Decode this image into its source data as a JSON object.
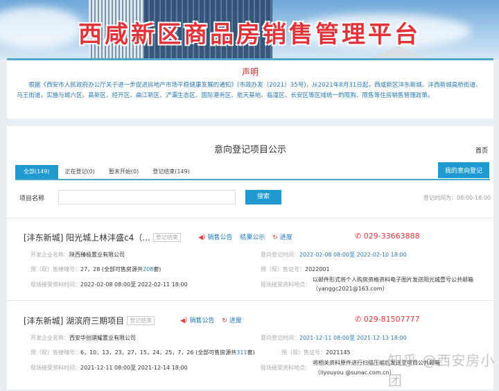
{
  "banner": {
    "title": "西咸新区商品房销售管理平台"
  },
  "notice": {
    "title": "声明",
    "body": "根据《西安市人民政府办公厅关于进一步促进房地产市场平稳健康发展的通知》(市政办发〔2021〕35号)，从2021年8月31日起，西咸新区沣东新城、沣西新城高桥街道、马王街道，实施与城六区、高新区、经开区、曲江新区、浐灞生态区、国际港务区、航天基地、临潼区、长安区等区域统一的限购、限售等住房销售管理政策。"
  },
  "page": {
    "title": "意向登记项目公示",
    "home": "首页",
    "my_button": "我的意向登记"
  },
  "tabs": [
    {
      "label": "全部(149)"
    },
    {
      "label": "正在登记(0)"
    },
    {
      "label": "暂未开始(0)"
    },
    {
      "label": "登记结束(149)"
    }
  ],
  "search": {
    "label": "项目名称",
    "value": "",
    "button": "搜索",
    "time_note": "登记时间为：08:00-18:00"
  },
  "items": [
    {
      "name": "[沣东新城] 阳光城上林沣盛c4（...",
      "badge": "登记结束",
      "links": [
        "销售公告",
        "结果公示",
        "进度"
      ],
      "phone": "029-33663888",
      "dev_k": "开发企业名称：",
      "dev_v": "陕西臻极置业有限公司",
      "reg_k": "意向登记时间：",
      "reg_v": "2022-02-08 08:00至 2022-02-10 18:00",
      "bld_k": "预（现）售楼幢号：",
      "bld_v": "27，28 (全部可售房源共",
      "bld_n": "208",
      "bld_s": "套)",
      "cert_k": "预（现）售证号：",
      "cert_v": "2022001",
      "site_k": "现场接受资料时间：",
      "site_v": "2022-02-08 08:00至 2022-02-11 18:00",
      "loc_k": "现场接受资料地点：",
      "loc_v1": "以邮件形式将个人购房资格资料电子图片发送阳光城壹号公共邮箱",
      "loc_v2": "（yanggc2021@163.com）"
    },
    {
      "name": "[沣东新城] 湖滨府三期项目",
      "badge": "登记结束",
      "links": [
        "销售公告",
        "进度"
      ],
      "phone": "029-81507777",
      "dev_k": "开发企业名称：",
      "dev_v": "西安华创骐耀置业有限公司",
      "reg_k": "意向登记时间：",
      "reg_v": "2021-12-11 08:00至 2021-12-13 18:00",
      "bld_k": "预（现）售楼幢号：",
      "bld_v": "6，10，13，23，27，15，24，25，7，26 (全部可售房源共",
      "bld_n": "311",
      "bld_s": "套)",
      "cert_k": "预（现）售证号：",
      "cert_v": "2021145",
      "site_k": "现场接受资料时间：",
      "site_v": "2021-12-11 08:00至 2021-12-14 18:00",
      "loc_k": "现场接受资料地点：",
      "loc_v1": "将相关资料原件进行扫描压缩后发送至项目公共邮箱",
      "loc_v2": "（liyouyou @sunac.com.cn）"
    }
  ],
  "watermark": "知乎 @西安房小团"
}
